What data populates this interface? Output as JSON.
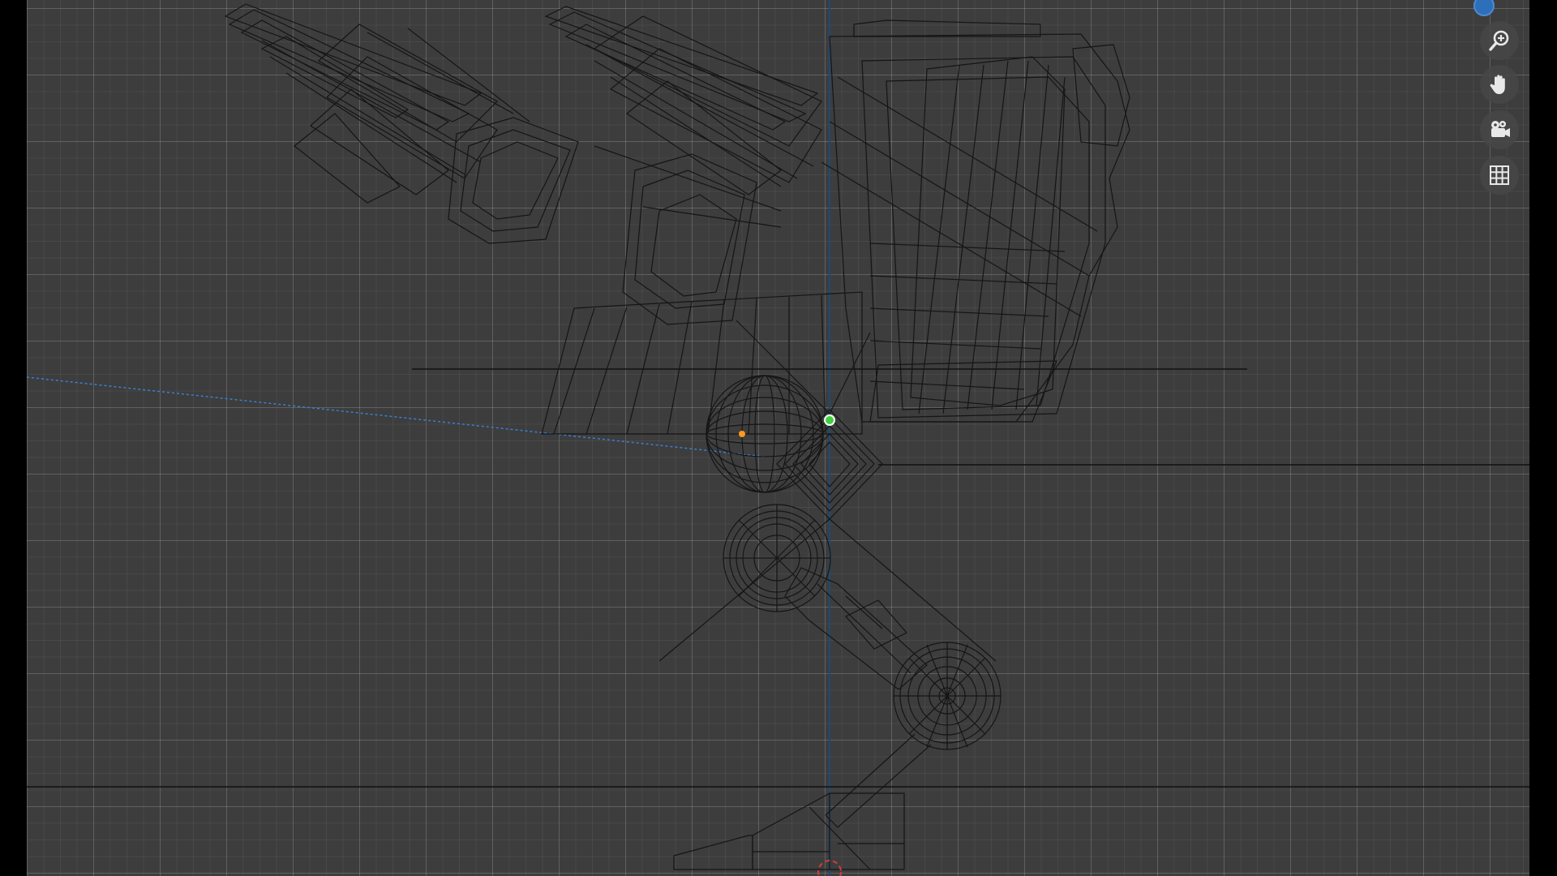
{
  "viewport": {
    "mode": "wireframe",
    "background_color": "#3d3d3d",
    "wire_color": "#111111"
  },
  "navigation": {
    "buttons": [
      {
        "name": "zoom-button",
        "icon": "magnifier-plus-icon"
      },
      {
        "name": "pan-button",
        "icon": "hand-icon"
      },
      {
        "name": "camera-view-button",
        "icon": "camera-icon"
      },
      {
        "name": "orthographic-toggle-button",
        "icon": "grid-icon"
      }
    ],
    "gizmo_axis_color": "#2d6fb8"
  },
  "markers": {
    "origin_color": "#ff9a1a",
    "light_color": "#3fd13f",
    "cursor_color": "#d43b3b",
    "axis_color": "#1e4a73"
  }
}
